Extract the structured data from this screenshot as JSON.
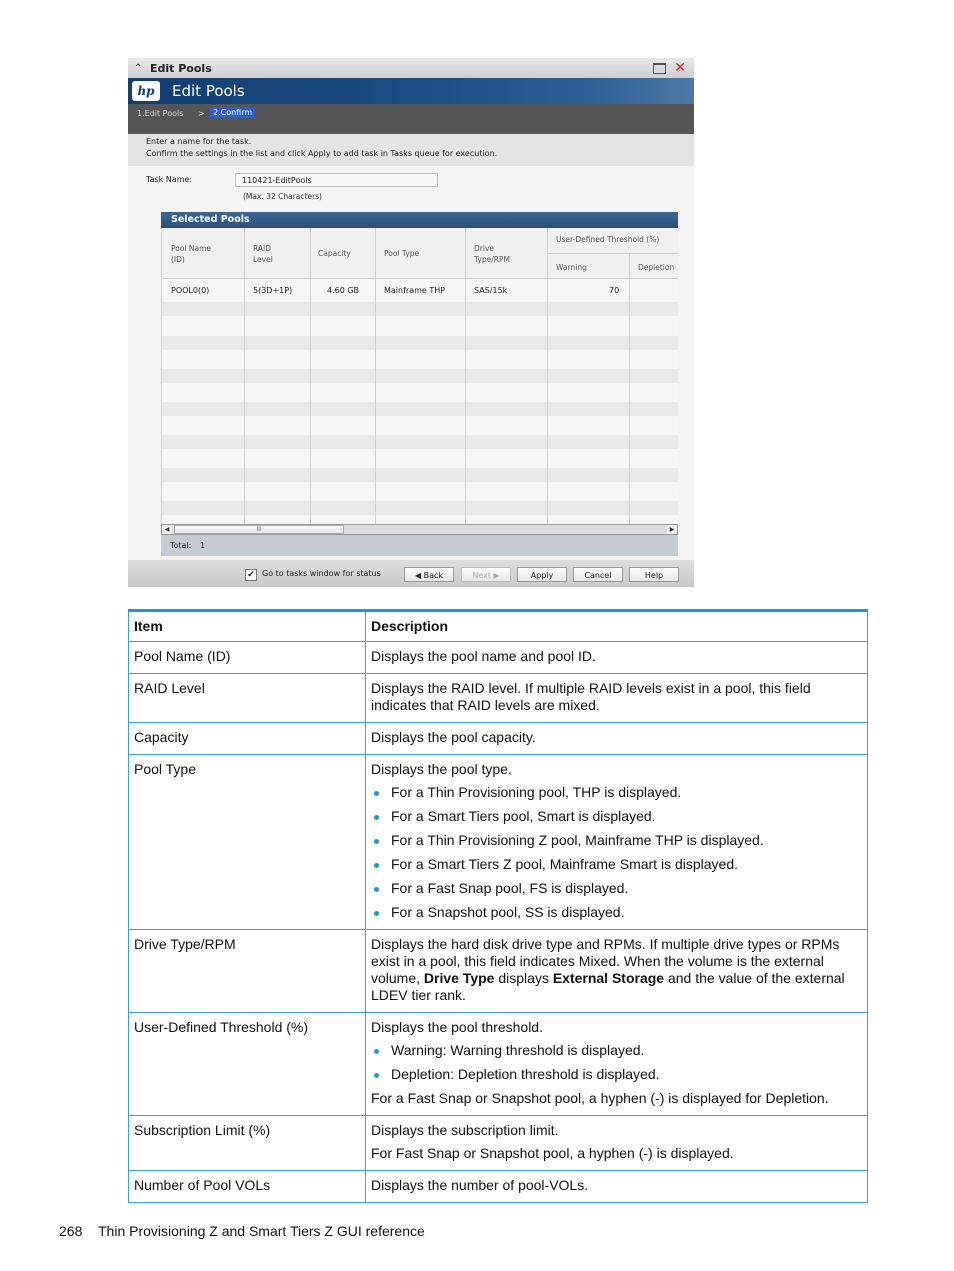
{
  "window": {
    "titlebar_title": "Edit Pools",
    "banner_logo": "hp",
    "banner_title": "Edit Pools",
    "steps": {
      "step1": "1.Edit Pools",
      "separator": ">",
      "step2": "2.Confirm"
    },
    "instructions": [
      "Enter a name for the task.",
      "Confirm the settings in the list and click Apply to add task in Tasks queue for execution."
    ],
    "task_name_label": "Task Name:",
    "task_name_value": "110421-EditPools",
    "task_name_hint": "(Max. 32 Characters)",
    "grid": {
      "title": "Selected Pools",
      "headers": {
        "pool_name": [
          "Pool Name",
          "(ID)"
        ],
        "raid_level": [
          "RAID",
          "Level"
        ],
        "capacity": "Capacity",
        "pool_type": "Pool Type",
        "drive": [
          "Drive",
          "Type/RPM"
        ],
        "threshold_group": "User-Defined Threshold (%)",
        "warning": "Warning",
        "depletion": "Depletion"
      },
      "rows": [
        {
          "pool_name": "POOL0(0)",
          "raid_level": "5(3D+1P)",
          "capacity": "4.60 GB",
          "pool_type": "Mainframe THP",
          "drive": "SAS/15k",
          "warning": "70",
          "depletion": ""
        }
      ],
      "scroll_thumb": "III",
      "total_label": "Total:",
      "total_value": "1"
    },
    "footer": {
      "checkbox_checked": true,
      "checkbox_label": "Go to tasks window for status",
      "back": "Back",
      "next": "Next",
      "apply": "Apply",
      "cancel": "Cancel",
      "help": "Help"
    }
  },
  "doc_table": {
    "headers": {
      "item": "Item",
      "description": "Description"
    },
    "rows": {
      "pool_name": {
        "item": "Pool Name (ID)",
        "desc": "Displays the pool name and pool ID."
      },
      "raid_level": {
        "item": "RAID Level",
        "desc": "Displays the RAID level. If multiple RAID levels exist in a pool, this field indicates that RAID levels are mixed."
      },
      "capacity": {
        "item": "Capacity",
        "desc": "Displays the pool capacity."
      },
      "pool_type": {
        "item": "Pool Type",
        "desc": "Displays the pool type.",
        "bullets": [
          "For a Thin Provisioning pool, THP is displayed.",
          "For a Smart Tiers pool, Smart is displayed.",
          "For a Thin Provisioning Z pool, Mainframe THP is displayed.",
          "For a Smart Tiers Z pool, Mainframe Smart is displayed.",
          "For a Fast Snap pool, FS is displayed.",
          "For a Snapshot pool, SS is displayed."
        ]
      },
      "drive_type": {
        "item": "Drive Type/RPM",
        "desc_part1": "Displays the hard disk drive type and RPMs. If multiple drive types or RPMs exist in a pool, this field indicates Mixed. When the volume is the external volume, ",
        "bold1": "Drive Type",
        "desc_part2": " displays ",
        "bold2": "External Storage",
        "desc_part3": " and the value of the external LDEV tier rank."
      },
      "threshold": {
        "item": "User-Defined Threshold (%)",
        "desc": "Displays the pool threshold.",
        "bullets": [
          "Warning: Warning threshold is displayed.",
          "Depletion: Depletion threshold is displayed."
        ],
        "after": "For a Fast Snap or Snapshot pool, a hyphen (-) is displayed for Depletion."
      },
      "subscription": {
        "item": "Subscription Limit (%)",
        "desc": "Displays the subscription limit.",
        "after": "For Fast Snap or Snapshot pool, a hyphen (-) is displayed."
      },
      "pool_vols": {
        "item": "Number of Pool VOLs",
        "desc": "Displays the number of pool-VOLs."
      }
    }
  },
  "page_footer": {
    "page_number": "268",
    "section_title": "Thin Provisioning Z and Smart Tiers Z GUI reference"
  },
  "colors": {
    "accent": "#1a9ad6",
    "banner": "#123e70",
    "step_active": "#2a5fcf",
    "close": "#dd2222"
  }
}
